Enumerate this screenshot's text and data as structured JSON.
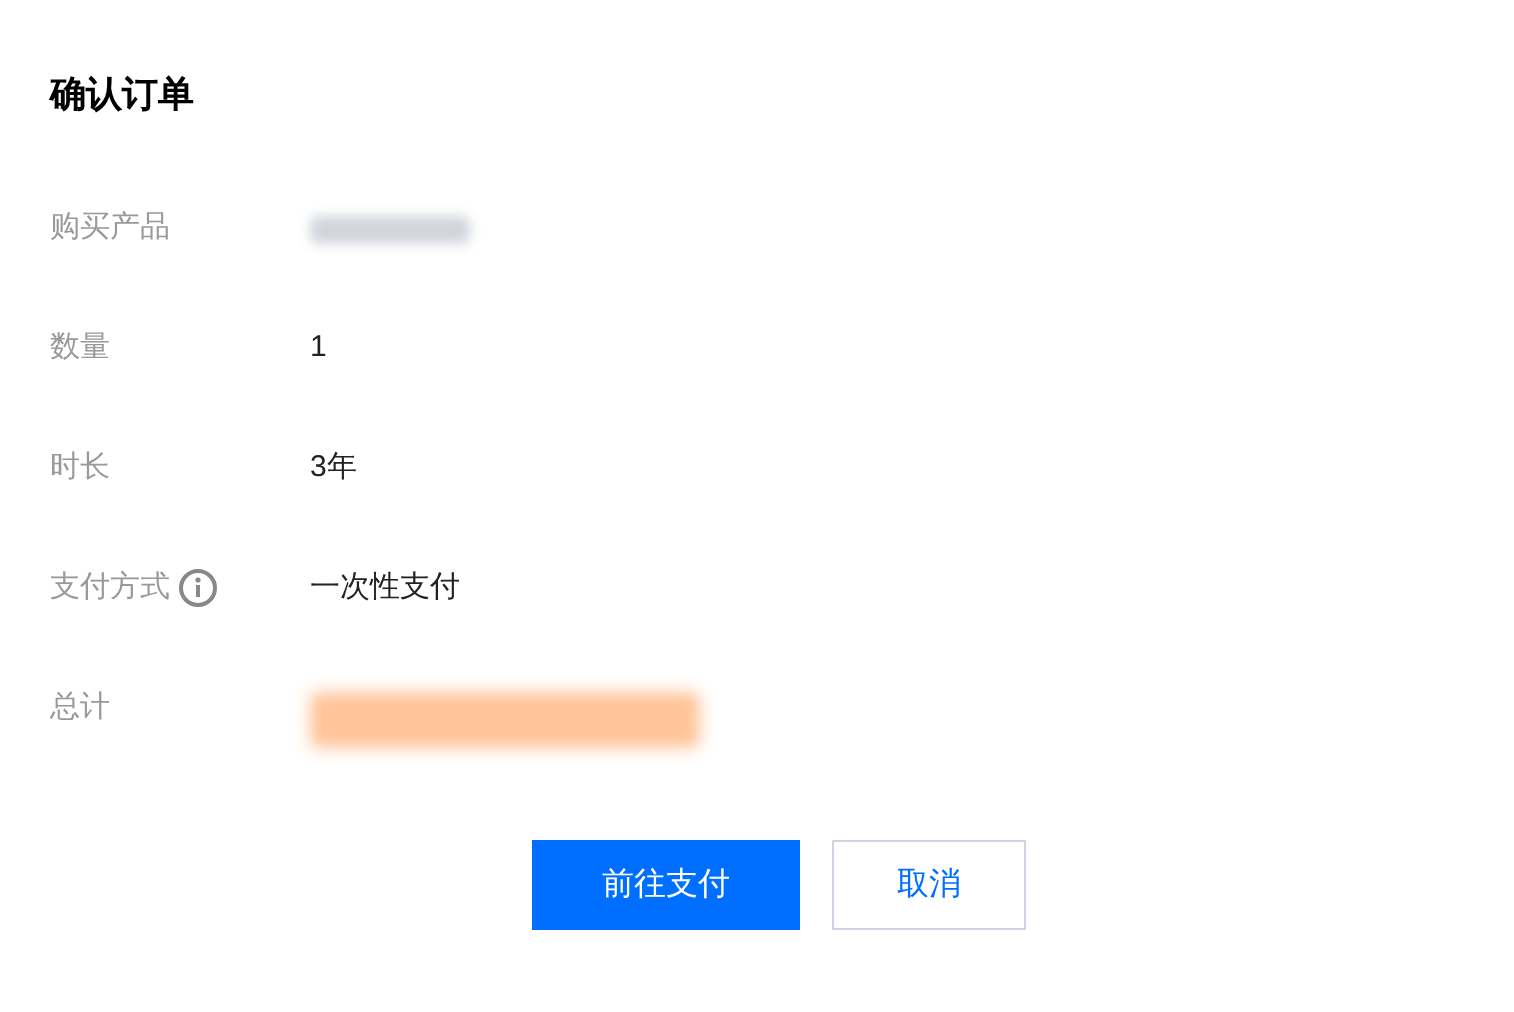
{
  "title": "确认订单",
  "rows": [
    {
      "label": "购买产品",
      "kind": "blurred",
      "color": "#d1d5db",
      "emphasis": false
    },
    {
      "label": "数量",
      "kind": "text",
      "value": "1"
    },
    {
      "label": "时长",
      "kind": "text",
      "value": "3年"
    },
    {
      "label": "支付方式",
      "kind": "text",
      "value": "一次性支付",
      "info": true
    },
    {
      "label": "总计",
      "kind": "blurred",
      "color": "#ffc49a",
      "emphasis": true
    }
  ],
  "buttons": [
    {
      "label": "前往支付",
      "kind": "primary"
    },
    {
      "label": "取消",
      "kind": "secondary"
    }
  ]
}
